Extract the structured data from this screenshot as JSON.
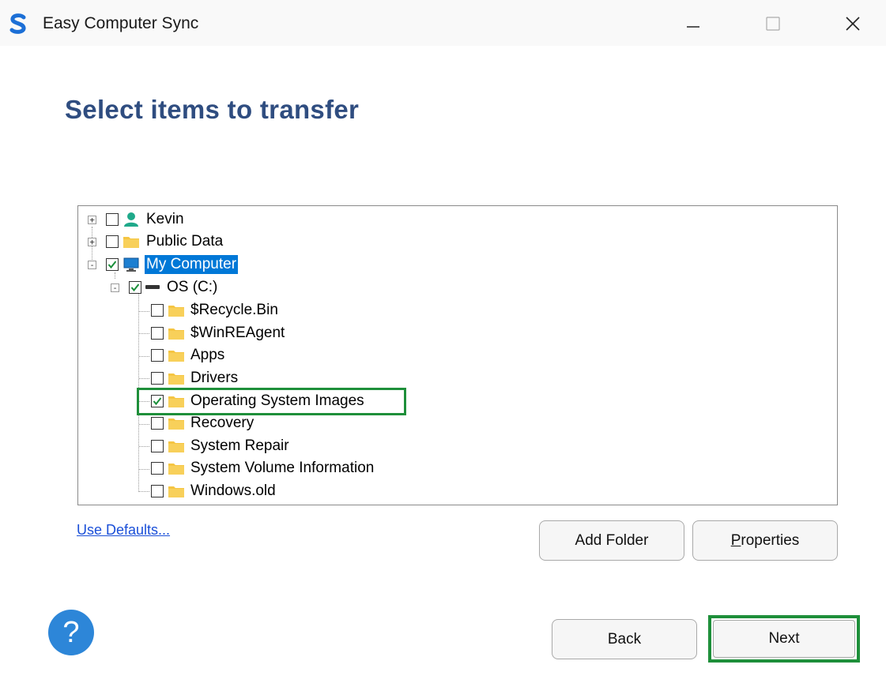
{
  "window": {
    "title": "Easy Computer Sync",
    "logo_letter": "S",
    "controls": [
      "minimize",
      "maximize",
      "close"
    ]
  },
  "heading": "Select items to transfer",
  "tree": {
    "items": [
      {
        "label": "Kevin",
        "checked": false,
        "expander": "+",
        "icon": "user-icon"
      },
      {
        "label": "Public Data",
        "checked": false,
        "expander": "+",
        "icon": "folder-icon"
      },
      {
        "label": "My Computer",
        "checked": true,
        "expander": "-",
        "icon": "monitor-icon",
        "selected": true
      },
      {
        "label": "OS (C:)",
        "checked": true,
        "expander": "-",
        "icon": "drive-icon"
      },
      {
        "label": "$Recycle.Bin",
        "checked": false,
        "icon": "folder-icon"
      },
      {
        "label": "$WinREAgent",
        "checked": false,
        "icon": "folder-icon"
      },
      {
        "label": "Apps",
        "checked": false,
        "icon": "folder-icon"
      },
      {
        "label": "Drivers",
        "checked": false,
        "icon": "folder-icon"
      },
      {
        "label": "Operating System Images",
        "checked": true,
        "icon": "folder-icon",
        "highlighted": true
      },
      {
        "label": "Recovery",
        "checked": false,
        "icon": "folder-icon"
      },
      {
        "label": "System Repair",
        "checked": false,
        "icon": "folder-icon"
      },
      {
        "label": "System Volume Information",
        "checked": false,
        "icon": "folder-icon"
      },
      {
        "label": "Windows.old",
        "checked": false,
        "icon": "folder-icon"
      }
    ]
  },
  "links": {
    "use_defaults": "Use Defaults..."
  },
  "buttons": {
    "add_folder": "Add Folder",
    "properties_mnemonic": "P",
    "properties_rest": "roperties",
    "back": "Back",
    "next": "Next",
    "help": "?"
  },
  "colors": {
    "heading": "#2f4d80",
    "selection": "#0078d7",
    "highlight": "#1e8f3a",
    "folder": "#f5c542",
    "user": "#1fa98a",
    "link": "#1a4fd8",
    "help": "#2d86d8"
  }
}
